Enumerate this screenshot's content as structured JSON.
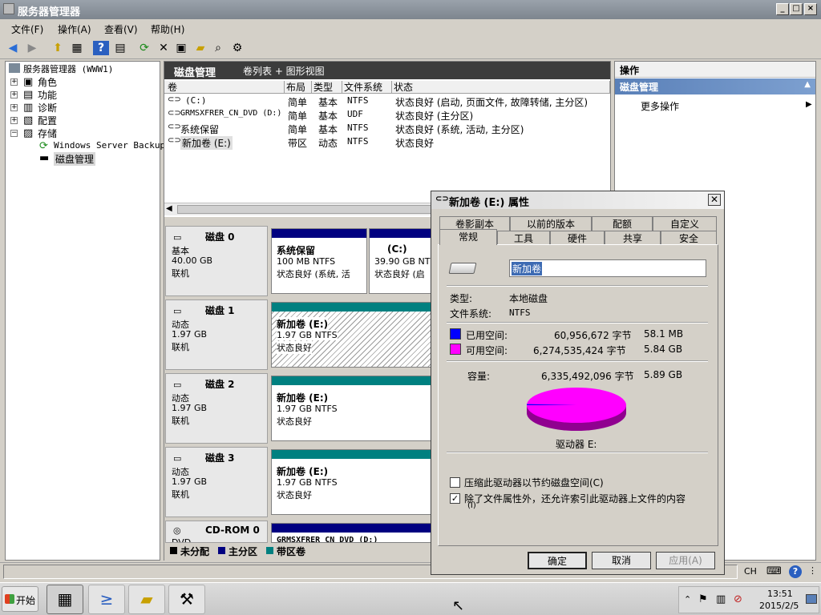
{
  "window": {
    "title": "服务器管理器"
  },
  "menu": [
    "文件(F)",
    "操作(A)",
    "查看(V)",
    "帮助(H)"
  ],
  "tree": {
    "root": "服务器管理器 (WWW1)",
    "items": [
      "角色",
      "功能",
      "诊断",
      "配置",
      "存储"
    ],
    "storage_children": [
      "Windows Server Backup",
      "磁盘管理"
    ]
  },
  "center": {
    "title": "磁盘管理",
    "view": "卷列表 + 图形视图",
    "columns": [
      "卷",
      "布局",
      "类型",
      "文件系统",
      "状态"
    ],
    "rows": [
      [
        "(C:)",
        "简单",
        "基本",
        "NTFS",
        "状态良好 (启动, 页面文件, 故障转储, 主分区)"
      ],
      [
        "GRMSXFRER_CN_DVD (D:)",
        "简单",
        "基本",
        "UDF",
        "状态良好 (主分区)"
      ],
      [
        "系统保留",
        "简单",
        "基本",
        "NTFS",
        "状态良好 (系统, 活动, 主分区)"
      ],
      [
        "新加卷 (E:)",
        "带区",
        "动态",
        "NTFS",
        "状态良好"
      ]
    ]
  },
  "disks": [
    {
      "name": "磁盘 0",
      "kind": "基本",
      "size": "40.00 GB",
      "state": "联机",
      "parts": [
        {
          "title": "系统保留",
          "info": "100 MB NTFS",
          "status": "状态良好 (系统, 活"
        },
        {
          "title": "(C:)",
          "info": "39.90 GB NTFS",
          "status": "状态良好 (启"
        }
      ]
    },
    {
      "name": "磁盘 1",
      "kind": "动态",
      "size": "1.97 GB",
      "state": "联机",
      "parts": [
        {
          "title": "新加卷  (E:)",
          "info": "1.97 GB NTFS",
          "status": "状态良好"
        }
      ]
    },
    {
      "name": "磁盘 2",
      "kind": "动态",
      "size": "1.97 GB",
      "state": "联机",
      "parts": [
        {
          "title": "新加卷  (E:)",
          "info": "1.97 GB NTFS",
          "status": "状态良好"
        }
      ]
    },
    {
      "name": "磁盘 3",
      "kind": "动态",
      "size": "1.97 GB",
      "state": "联机",
      "parts": [
        {
          "title": "新加卷  (E:)",
          "info": "1.97 GB NTFS",
          "status": "状态良好"
        }
      ]
    },
    {
      "name": "CD-ROM 0",
      "kind": "DVD",
      "size": "",
      "state": "",
      "parts": [
        {
          "title": "GRMSXFRER_CN_DVD (D:)",
          "info": "",
          "status": ""
        }
      ]
    }
  ],
  "legend": [
    "未分配",
    "主分区",
    "带区卷"
  ],
  "colors": {
    "unallocated": "#000000",
    "primary": "#000080",
    "striped": "#008080",
    "used": "#0000ff",
    "free": "#ff00ff"
  },
  "actions": {
    "title": "操作",
    "section": "磁盘管理",
    "more": "更多操作"
  },
  "dialog": {
    "title": "新加卷 (E:) 属性",
    "tabs_row1": [
      "卷影副本",
      "以前的版本",
      "配额",
      "自定义"
    ],
    "tabs_row2": [
      "常规",
      "工具",
      "硬件",
      "共享",
      "安全"
    ],
    "label_value": "新加卷",
    "type_label": "类型:",
    "type_value": "本地磁盘",
    "fs_label": "文件系统:",
    "fs_value": "NTFS",
    "used_label": "已用空间:",
    "used_bytes": "60,956,672 字节",
    "used_size": "58.1 MB",
    "free_label": "可用空间:",
    "free_bytes": "6,274,535,424 字节",
    "free_size": "5.84 GB",
    "cap_label": "容量:",
    "cap_bytes": "6,335,492,096 字节",
    "cap_size": "5.89 GB",
    "drive_label": "驱动器 E:",
    "used_fraction": 0.0096,
    "compress_label": "压缩此驱动器以节约磁盘空间(C)",
    "compress_checked": false,
    "index_label": "除了文件属性外，还允许索引此驱动器上文件的内容",
    "index_label2": "(I)",
    "index_checked": true,
    "ok": "确定",
    "cancel": "取消",
    "apply": "应用(A)"
  },
  "statusbar": {
    "ime": "CH"
  },
  "taskbar": {
    "start": "开始",
    "time": "13:51",
    "date": "2015/2/5"
  }
}
